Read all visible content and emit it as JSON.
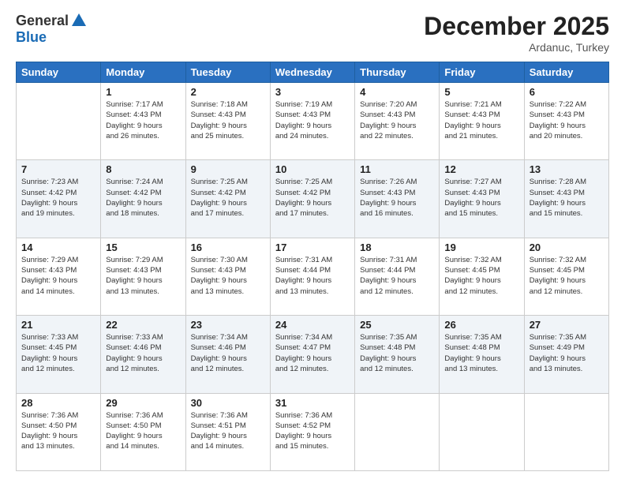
{
  "logo": {
    "general": "General",
    "blue": "Blue"
  },
  "title": "December 2025",
  "location": "Ardanuc, Turkey",
  "headers": [
    "Sunday",
    "Monday",
    "Tuesday",
    "Wednesday",
    "Thursday",
    "Friday",
    "Saturday"
  ],
  "weeks": [
    [
      {
        "day": "",
        "info": ""
      },
      {
        "day": "1",
        "info": "Sunrise: 7:17 AM\nSunset: 4:43 PM\nDaylight: 9 hours\nand 26 minutes."
      },
      {
        "day": "2",
        "info": "Sunrise: 7:18 AM\nSunset: 4:43 PM\nDaylight: 9 hours\nand 25 minutes."
      },
      {
        "day": "3",
        "info": "Sunrise: 7:19 AM\nSunset: 4:43 PM\nDaylight: 9 hours\nand 24 minutes."
      },
      {
        "day": "4",
        "info": "Sunrise: 7:20 AM\nSunset: 4:43 PM\nDaylight: 9 hours\nand 22 minutes."
      },
      {
        "day": "5",
        "info": "Sunrise: 7:21 AM\nSunset: 4:43 PM\nDaylight: 9 hours\nand 21 minutes."
      },
      {
        "day": "6",
        "info": "Sunrise: 7:22 AM\nSunset: 4:43 PM\nDaylight: 9 hours\nand 20 minutes."
      }
    ],
    [
      {
        "day": "7",
        "info": "Sunrise: 7:23 AM\nSunset: 4:42 PM\nDaylight: 9 hours\nand 19 minutes."
      },
      {
        "day": "8",
        "info": "Sunrise: 7:24 AM\nSunset: 4:42 PM\nDaylight: 9 hours\nand 18 minutes."
      },
      {
        "day": "9",
        "info": "Sunrise: 7:25 AM\nSunset: 4:42 PM\nDaylight: 9 hours\nand 17 minutes."
      },
      {
        "day": "10",
        "info": "Sunrise: 7:25 AM\nSunset: 4:42 PM\nDaylight: 9 hours\nand 17 minutes."
      },
      {
        "day": "11",
        "info": "Sunrise: 7:26 AM\nSunset: 4:43 PM\nDaylight: 9 hours\nand 16 minutes."
      },
      {
        "day": "12",
        "info": "Sunrise: 7:27 AM\nSunset: 4:43 PM\nDaylight: 9 hours\nand 15 minutes."
      },
      {
        "day": "13",
        "info": "Sunrise: 7:28 AM\nSunset: 4:43 PM\nDaylight: 9 hours\nand 15 minutes."
      }
    ],
    [
      {
        "day": "14",
        "info": "Sunrise: 7:29 AM\nSunset: 4:43 PM\nDaylight: 9 hours\nand 14 minutes."
      },
      {
        "day": "15",
        "info": "Sunrise: 7:29 AM\nSunset: 4:43 PM\nDaylight: 9 hours\nand 13 minutes."
      },
      {
        "day": "16",
        "info": "Sunrise: 7:30 AM\nSunset: 4:43 PM\nDaylight: 9 hours\nand 13 minutes."
      },
      {
        "day": "17",
        "info": "Sunrise: 7:31 AM\nSunset: 4:44 PM\nDaylight: 9 hours\nand 13 minutes."
      },
      {
        "day": "18",
        "info": "Sunrise: 7:31 AM\nSunset: 4:44 PM\nDaylight: 9 hours\nand 12 minutes."
      },
      {
        "day": "19",
        "info": "Sunrise: 7:32 AM\nSunset: 4:45 PM\nDaylight: 9 hours\nand 12 minutes."
      },
      {
        "day": "20",
        "info": "Sunrise: 7:32 AM\nSunset: 4:45 PM\nDaylight: 9 hours\nand 12 minutes."
      }
    ],
    [
      {
        "day": "21",
        "info": "Sunrise: 7:33 AM\nSunset: 4:45 PM\nDaylight: 9 hours\nand 12 minutes."
      },
      {
        "day": "22",
        "info": "Sunrise: 7:33 AM\nSunset: 4:46 PM\nDaylight: 9 hours\nand 12 minutes."
      },
      {
        "day": "23",
        "info": "Sunrise: 7:34 AM\nSunset: 4:46 PM\nDaylight: 9 hours\nand 12 minutes."
      },
      {
        "day": "24",
        "info": "Sunrise: 7:34 AM\nSunset: 4:47 PM\nDaylight: 9 hours\nand 12 minutes."
      },
      {
        "day": "25",
        "info": "Sunrise: 7:35 AM\nSunset: 4:48 PM\nDaylight: 9 hours\nand 12 minutes."
      },
      {
        "day": "26",
        "info": "Sunrise: 7:35 AM\nSunset: 4:48 PM\nDaylight: 9 hours\nand 13 minutes."
      },
      {
        "day": "27",
        "info": "Sunrise: 7:35 AM\nSunset: 4:49 PM\nDaylight: 9 hours\nand 13 minutes."
      }
    ],
    [
      {
        "day": "28",
        "info": "Sunrise: 7:36 AM\nSunset: 4:50 PM\nDaylight: 9 hours\nand 13 minutes."
      },
      {
        "day": "29",
        "info": "Sunrise: 7:36 AM\nSunset: 4:50 PM\nDaylight: 9 hours\nand 14 minutes."
      },
      {
        "day": "30",
        "info": "Sunrise: 7:36 AM\nSunset: 4:51 PM\nDaylight: 9 hours\nand 14 minutes."
      },
      {
        "day": "31",
        "info": "Sunrise: 7:36 AM\nSunset: 4:52 PM\nDaylight: 9 hours\nand 15 minutes."
      },
      {
        "day": "",
        "info": ""
      },
      {
        "day": "",
        "info": ""
      },
      {
        "day": "",
        "info": ""
      }
    ]
  ]
}
